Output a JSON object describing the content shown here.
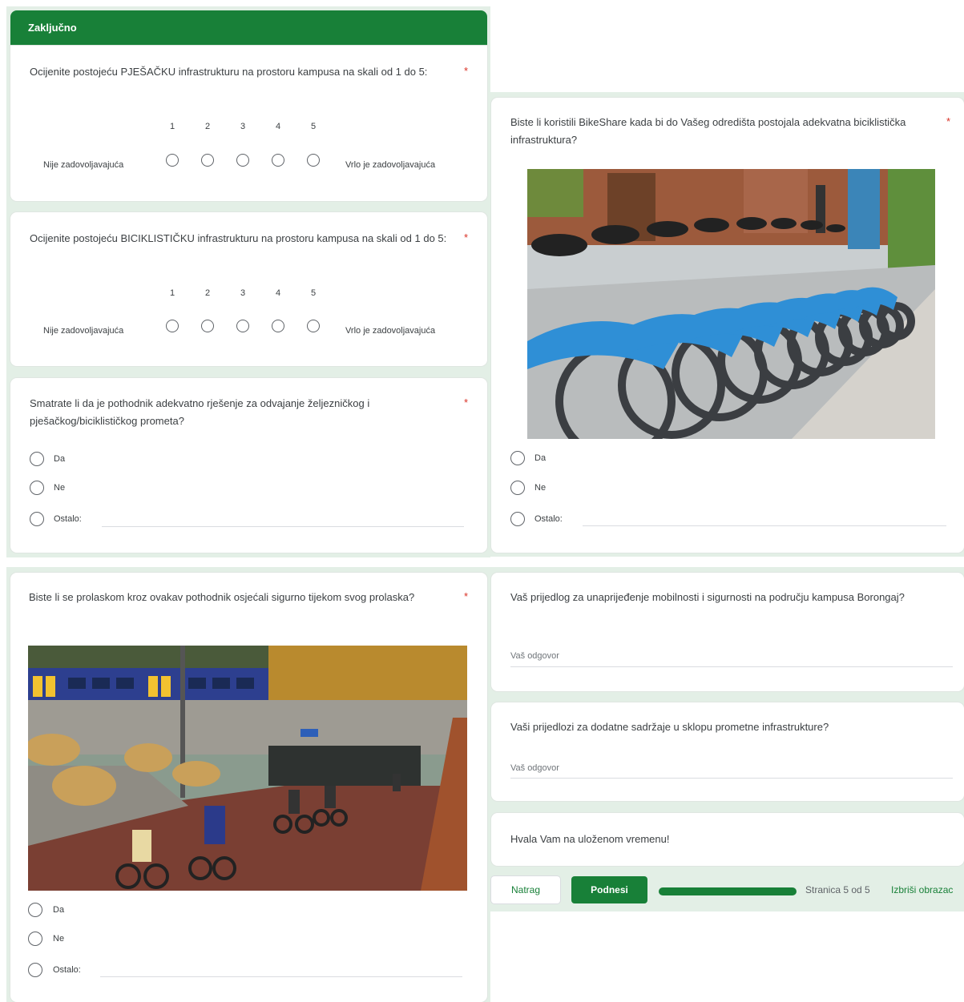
{
  "section_title": "Zaključno",
  "q1": {
    "text": "Ocijenite postojeću PJEŠAČKU infrastrukturu na prostoru kampusa na skali od 1 do 5:",
    "required": "*",
    "scale": [
      "1",
      "2",
      "3",
      "4",
      "5"
    ],
    "low_label": "Nije zadovoljavajuća",
    "high_label": "Vrlo je zadovoljavajuća"
  },
  "q2": {
    "text": "Ocijenite postojeću BICIKLISTIČKU infrastrukturu na prostoru kampusa na skali od 1 do 5:",
    "required": "*",
    "scale": [
      "1",
      "2",
      "3",
      "4",
      "5"
    ],
    "low_label": "Nije zadovoljavajuća",
    "high_label": "Vrlo je zadovoljavajuća"
  },
  "q3": {
    "text": "Smatrate li da je pothodnik adekvatno rješenje za odvajanje željezničkog i pješačkog/biciklističkog prometa?",
    "required": "*",
    "options": [
      "Da",
      "Ne",
      "Ostalo:"
    ]
  },
  "q4": {
    "text": "Biste li koristili BikeShare kada bi do Vašeg odredišta postojala adekvatna biciklistička infrastruktura?",
    "required": "*",
    "options": [
      "Da",
      "Ne",
      "Ostalo:"
    ]
  },
  "q5": {
    "text": "Biste li se prolaskom kroz ovakav pothodnik osjećali sigurno tijekom svog prolaska?",
    "required": "*",
    "options": [
      "Da",
      "Ne",
      "Ostalo:"
    ]
  },
  "q6": {
    "text": "Vaš prijedlog za unaprijeđenje mobilnosti i sigurnosti na području kampusa Borongaj?",
    "placeholder": "Vaš odgovor"
  },
  "q7": {
    "text": "Vaši prijedlozi za dodatne sadržaje u sklopu prometne infrastrukture?",
    "placeholder": "Vaš odgovor"
  },
  "thanks": "Hvala Vam na uloženom vremenu!",
  "nav": {
    "back": "Natrag",
    "submit": "Podnesi",
    "page_indicator": "Stranica 5 od 5",
    "clear": "Izbriši obrazac",
    "progress": 1.0
  },
  "colors": {
    "accent": "#188038",
    "background": "#e3efe6",
    "required": "#d93025"
  }
}
